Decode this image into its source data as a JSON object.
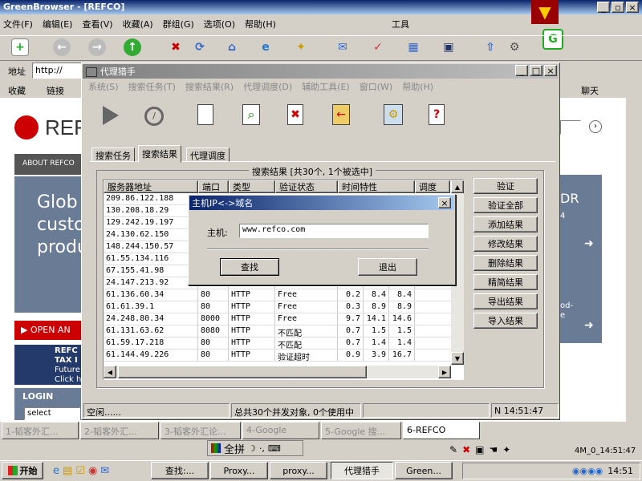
{
  "browser": {
    "title": "GreenBrowser - [REFCO]",
    "menu": [
      "文件(F)",
      "编辑(E)",
      "查看(V)",
      "收藏(A)",
      "群组(G)",
      "选项(O)",
      "帮助(H)"
    ],
    "tools_label": "工具",
    "address_label": "地址",
    "address_value": "http://",
    "favorites_label": "收藏",
    "links_label": "链接",
    "chat_label": "聊天"
  },
  "website": {
    "logo": "REF",
    "about": "ABOUT REFCO",
    "hero1": "Glob",
    "hero2": "custo",
    "hero3": "produ",
    "hero_right": "DR",
    "hero_right2": "4",
    "hero_right3": "od-",
    "hero_right4": "e",
    "open_account": "OPEN AN",
    "tax_title": "REFC",
    "tax_sub": "TAX I",
    "tax_sub2": "Future",
    "tax_sub3": "Click h",
    "login": "LOGIN",
    "select": "select"
  },
  "proxy_window": {
    "title": "代理猎手",
    "menu": [
      "系统(S)",
      "搜索任务(T)",
      "搜索结果(R)",
      "代理调度(D)",
      "辅助工具(E)",
      "窗口(W)",
      "帮助(H)"
    ],
    "tabs": [
      "搜索任务",
      "搜索结果",
      "代理调度"
    ],
    "results_caption": "搜索结果 [共30个, 1个被选中]",
    "columns": [
      "服务器地址",
      "端口",
      "类型",
      "验证状态",
      "时间特性",
      "调度"
    ],
    "rows": [
      [
        "209.86.122.188",
        "",
        "",
        "",
        "",
        "",
        ""
      ],
      [
        "130.208.18.29",
        "",
        "",
        "",
        "",
        "",
        ""
      ],
      [
        "129.242.19.197",
        "",
        "",
        "",
        "",
        "",
        ""
      ],
      [
        "24.130.62.150",
        "",
        "",
        "",
        "",
        "",
        ""
      ],
      [
        "148.244.150.57",
        "",
        "",
        "",
        "",
        "",
        ""
      ],
      [
        "61.55.134.116",
        "",
        "",
        "",
        "",
        "",
        ""
      ],
      [
        "67.155.41.98",
        "",
        "",
        "",
        "",
        "",
        ""
      ],
      [
        "24.147.213.92",
        "",
        "",
        "",
        "",
        "",
        ""
      ],
      [
        "61.136.60.34",
        "80",
        "HTTP",
        "Free",
        "0.2",
        "8.4",
        "8.4"
      ],
      [
        "61.61.39.1",
        "80",
        "HTTP",
        "Free",
        "0.3",
        "8.9",
        "8.9"
      ],
      [
        "24.248.80.34",
        "8000",
        "HTTP",
        "Free",
        "9.7",
        "14.1",
        "14.6"
      ],
      [
        "61.131.63.62",
        "8080",
        "HTTP",
        "不匹配",
        "0.7",
        "1.5",
        "1.5"
      ],
      [
        "61.59.17.218",
        "80",
        "HTTP",
        "不匹配",
        "0.7",
        "1.4",
        "1.4"
      ],
      [
        "61.144.49.226",
        "80",
        "HTTP",
        "验证超时",
        "0.9",
        "3.9",
        "16.7"
      ]
    ],
    "buttons": [
      "验证",
      "验证全部",
      "添加结果",
      "修改结果",
      "删除结果",
      "精简结果",
      "导出结果",
      "导入结果"
    ],
    "status_left": "空闲......",
    "status_mid": "总共30个并发对象, 0个使用中",
    "status_right": "N 14:51:47"
  },
  "dialog": {
    "title": "主机IP<->域名",
    "host_label": "主机:",
    "host_value": "www.refco.com",
    "find": "查找",
    "exit": "退出"
  },
  "browser_tabs": [
    "1-韬客外汇...",
    "2-韬客外汇...",
    "3-韬客外汇论...",
    "4-Google",
    "5-Google 搜...",
    "6-REFCO"
  ],
  "browser_status": {
    "ime": "全拼",
    "time": "4M_0_14:51:47"
  },
  "taskbar": {
    "start": "开始",
    "items": [
      "查找:...",
      "Proxy...",
      "proxy...",
      "代理猎手",
      "Green..."
    ],
    "clock": "14:51"
  }
}
